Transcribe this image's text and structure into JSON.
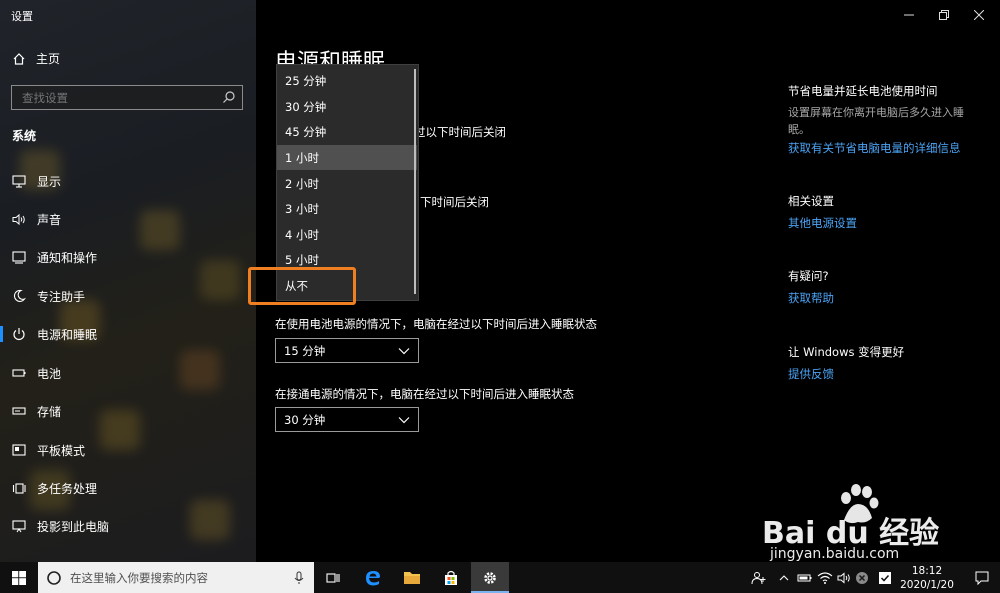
{
  "window": {
    "title": "设置",
    "controls": {
      "minimize_icon": "minimize-icon",
      "restore_icon": "restore-icon",
      "close_icon": "close-icon"
    }
  },
  "sidebar": {
    "home_label": "主页",
    "search_placeholder": "查找设置",
    "section_label": "系统",
    "items": [
      {
        "label": "显示",
        "icon": "monitor-icon"
      },
      {
        "label": "声音",
        "icon": "speaker-icon"
      },
      {
        "label": "通知和操作",
        "icon": "notification-icon"
      },
      {
        "label": "专注助手",
        "icon": "moon-icon"
      },
      {
        "label": "电源和睡眠",
        "icon": "power-icon",
        "active": true
      },
      {
        "label": "电池",
        "icon": "battery-icon"
      },
      {
        "label": "存储",
        "icon": "storage-icon"
      },
      {
        "label": "平板模式",
        "icon": "tablet-icon"
      },
      {
        "label": "多任务处理",
        "icon": "multitask-icon"
      },
      {
        "label": "投影到此电脑",
        "icon": "project-icon"
      }
    ]
  },
  "main": {
    "page_title": "电源和睡眠",
    "screen_battery_partial": "过以下时间后关闭",
    "screen_plugged_partial": "下时间后关闭",
    "sleep_battery_label": "在使用电池电源的情况下，电脑在经过以下时间后进入睡眠状态",
    "sleep_battery_value": "15 分钟",
    "sleep_plugged_label": "在接通电源的情况下，电脑在经过以下时间后进入睡眠状态",
    "sleep_plugged_value": "30 分钟"
  },
  "dropdown": {
    "options": [
      "25 分钟",
      "30 分钟",
      "45 分钟",
      "1 小时",
      "2 小时",
      "3 小时",
      "4 小时",
      "5 小时",
      "从不"
    ],
    "selected": "1 小时"
  },
  "right_panel": {
    "save_head": "节省电量并延长电池使用时间",
    "save_desc": "设置屏幕在你离开电脑后多久进入睡眠。",
    "save_link": "获取有关节省电脑电量的详细信息",
    "related_head": "相关设置",
    "related_link": "其他电源设置",
    "question_head": "有疑问?",
    "help_link": "获取帮助",
    "improve_head": "让 Windows 变得更好",
    "feedback_link": "提供反馈"
  },
  "taskbar": {
    "search_placeholder": "在这里输入你要搜索的内容",
    "time": "18:12",
    "date": "2020/1/20"
  },
  "watermark": {
    "brand": "Bai du 经验",
    "url": "jingyan.baidu.com"
  },
  "colors": {
    "accent": "#1e90ff",
    "link": "#4ba3f5",
    "highlight": "#f07f22"
  }
}
